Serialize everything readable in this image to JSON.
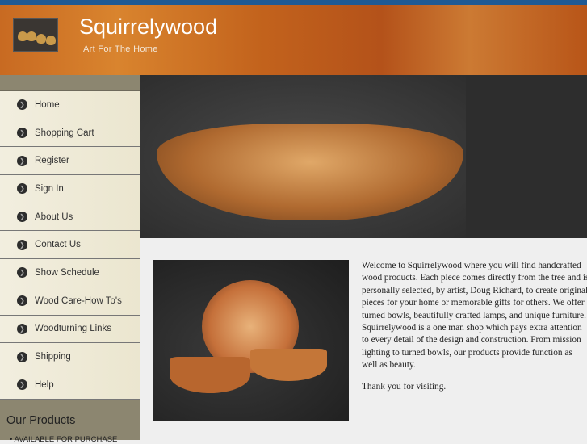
{
  "header": {
    "title": "Squirrelywood",
    "tagline": "Art For The Home"
  },
  "menu": [
    "Home",
    "Shopping Cart",
    "Register",
    "Sign In",
    "About Us",
    "Contact Us",
    "Show Schedule",
    "Wood Care-How To's",
    "Woodturning Links",
    "Shipping",
    "Help"
  ],
  "products": {
    "title": "Our Products",
    "items": [
      "AVAILABLE FOR PURCHASE"
    ]
  },
  "content": {
    "welcome": "Welcome to Squirrelywood where you will find handcrafted wood products. Each piece comes directly from the tree and is personally selected, by artist, Doug Richard, to create original pieces for your home or memorable gifts for others. We offer turned bowls, beautifully crafted lamps, and unique furniture. Squirrelywood is a one man shop which pays extra attention to every detail of the design and construction. From mission lighting to turned bowls, our products provide function as well as beauty.",
    "thanks": "Thank you for visiting."
  }
}
